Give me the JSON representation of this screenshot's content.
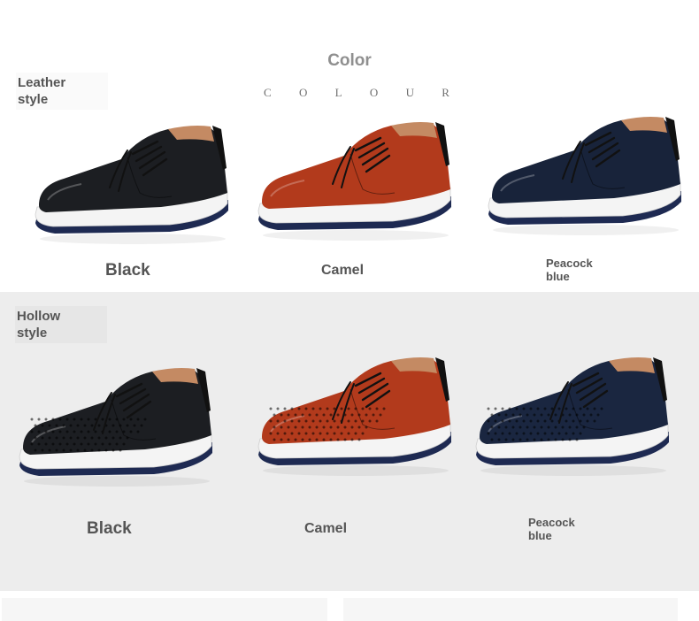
{
  "header": {
    "title": "Color",
    "subtitle_letters": [
      "C",
      "O",
      "L",
      "O",
      "U",
      "R"
    ]
  },
  "rows": [
    {
      "style_label": "Leather\nstyle",
      "variant": "leather",
      "items": [
        {
          "color_name": "Black",
          "upper_color": "#1c1e22"
        },
        {
          "color_name": "Camel",
          "upper_color": "#b23a1c"
        },
        {
          "color_name": "Peacock\nblue",
          "upper_color": "#18233a"
        }
      ]
    },
    {
      "style_label": "Hollow\nstyle",
      "variant": "hollow",
      "items": [
        {
          "color_name": "Black",
          "upper_color": "#1c1e22"
        },
        {
          "color_name": "Camel",
          "upper_color": "#b23a1c"
        },
        {
          "color_name": "Peacock\nblue",
          "upper_color": "#1a2640"
        }
      ]
    }
  ],
  "colors": {
    "lining": "#c48a63",
    "midsole": "#f4f4f4",
    "outsole": "#1e2a52",
    "label_text": "#555555",
    "title_text": "#8f8f8f"
  }
}
